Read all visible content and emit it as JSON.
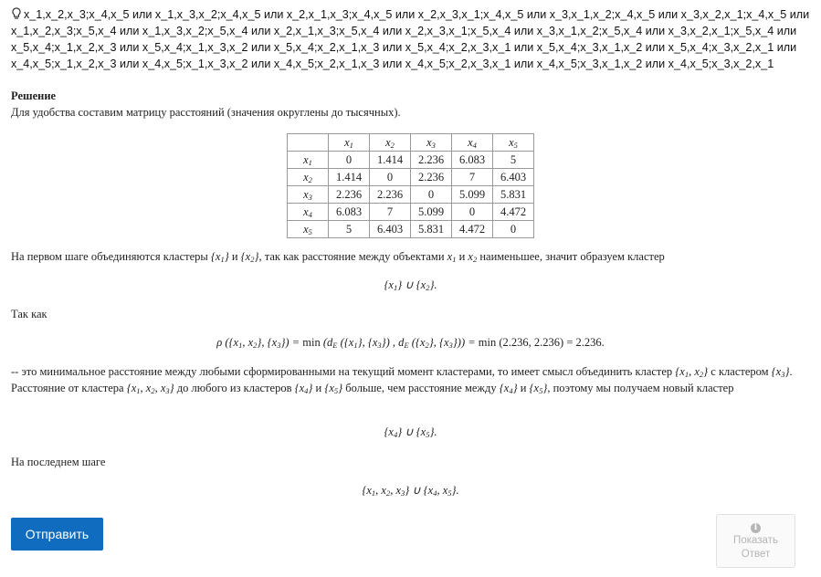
{
  "answer": {
    "line": "x_1,x_2,x_3;x_4,x_5 или x_1,x_3,x_2;x_4,x_5 или x_2,x_1,x_3;x_4,x_5 или x_2,x_3,x_1;x_4,x_5 или x_3,x_1,x_2;x_4,x_5 или x_3,x_2,x_1;x_4,x_5 или x_1,x_2,x_3;x_5,x_4 или x_1,x_3,x_2;x_5,x_4 или x_2,x_1,x_3;x_5,x_4 или x_2,x_3,x_1;x_5,x_4 или x_3,x_1,x_2;x_5,x_4 или x_3,x_2,x_1;x_5,x_4 или x_5,x_4;x_1,x_2,x_3 или x_5,x_4;x_1,x_3,x_2 или x_5,x_4;x_2,x_1,x_3 или x_5,x_4;x_2,x_3,x_1 или x_5,x_4;x_3,x_1,x_2 или x_5,x_4;x_3,x_2,x_1 или x_4,x_5;x_1,x_2,x_3 или x_4,x_5;x_1,x_3,x_2 или x_4,x_5;x_2,x_1,x_3 или x_4,x_5;x_2,x_3,x_1 или x_4,x_5;x_3,x_1,x_2 или x_4,x_5;x_3,x_2,x_1",
    "icon": "lightbulb-icon"
  },
  "solution": {
    "heading": "Решение",
    "intro": "Для удобства составим матрицу расстояний (значения округлены до тысячных).",
    "table": {
      "columns": [
        "x1",
        "x2",
        "x3",
        "x4",
        "x5"
      ],
      "rows": [
        {
          "label": "x1",
          "cells": [
            "0",
            "1.414",
            "2.236",
            "6.083",
            "5"
          ]
        },
        {
          "label": "x2",
          "cells": [
            "1.414",
            "0",
            "2.236",
            "7",
            "6.403"
          ]
        },
        {
          "label": "x3",
          "cells": [
            "2.236",
            "2.236",
            "0",
            "5.099",
            "5.831"
          ]
        },
        {
          "label": "x4",
          "cells": [
            "6.083",
            "7",
            "5.099",
            "0",
            "4.472"
          ]
        },
        {
          "label": "x5",
          "cells": [
            "5",
            "6.403",
            "5.831",
            "4.472",
            "0"
          ]
        }
      ]
    },
    "step1": {
      "p1": "На первом шаге объединяются кластеры ",
      "and": " и ",
      "p2": ", так как расстояние между объектами ",
      "p3": " наименьшее, значит образуем кластер"
    },
    "sotak": "Так как",
    "formula_min": "min",
    "formula_result": "min (2.236, 2.236) = 2.236.",
    "step2": {
      "p1": "-- это минимальное расстояние между любыми сформированными на текущий момент кластерами, то имеет смысл объединить кластер ",
      "p2": " с кластером ",
      "p3": ". Расстояние от кластера ",
      "p4": " до любого из кластеров ",
      "p5": " больше, чем расстояние между ",
      "p6": ", поэтому мы получаем новый кластер"
    },
    "last_step": "На последнем шаге"
  },
  "buttons": {
    "submit_label": "Отправить",
    "show_answer_label_1": "Показать",
    "show_answer_label_2": "Ответ",
    "info_glyph": "i"
  }
}
